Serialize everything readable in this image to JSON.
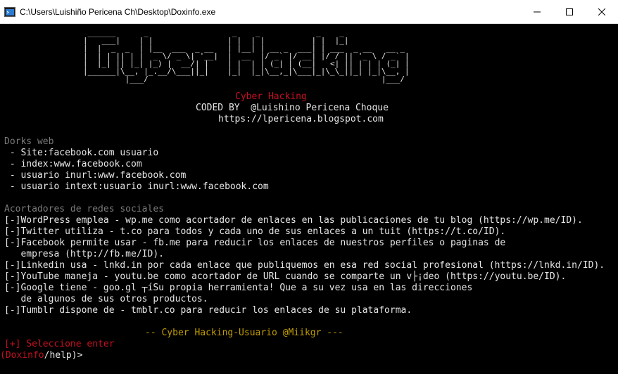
{
  "window": {
    "title": "C:\\Users\\Luishiño Pericena Ch\\Desktop\\Doxinfo.exe"
  },
  "banner": {
    "art": [
      " ______      _                  _    _            _    _             ",
      "|   ___|    | |                | |  | |          | |  |_|            ",
      "|  |  _  _  | |__  ___  _ __   | |__| | __ _  ___| | ___  _ __   __ _",
      "|  | | || | |  _ \\/ _ \\| '__|  |  __  |/ _` |/ __| |/ / || '_ \\ / _` |",
      "|  |_| || |_| |_) |  __/| |    | |  | | (_| | (__|   <| || | | | (_| |",
      "|______|\\__, |_.__/\\___||_|    |_|  |_|\\__,_|\\___|_|\\_\\_||_| |_|\\__, |",
      "         |___/                                                  |___/ "
    ],
    "title": "Cyber Hacking",
    "coded_by": "CODED BY  @Luishino Pericena Choque",
    "url": "https://lpericena.blogspot.com"
  },
  "dorks": {
    "heading": "Dorks web",
    "items": [
      " - Site:facebook.com usuario",
      " - index:www.facebook.com",
      " - usuario inurl:www.facebook.com",
      " - usuario intext:usuario inurl:www.facebook.com"
    ]
  },
  "shorteners": {
    "heading": "Acortadores de redes sociales",
    "lines": [
      "[-]WordPress emplea - wp.me como acortador de enlaces en las publicaciones de tu blog (https://wp.me/ID).",
      "[-]Twitter utiliza - t.co para todos y cada uno de sus enlaces a un tuit (https://t.co/ID).",
      "[-]Facebook permite usar - fb.me para reducir los enlaces de nuestros perfiles o paginas de",
      "   empresa (http://fb.me/ID).",
      "[-]Linkedin usa - lnkd.in por cada enlace que publiquemos en esa red social profesional (https://lnkd.in/ID).",
      "[-]YouTube maneja - youtu.be como acortador de URL cuando se comparte un v├¡deo (https://youtu.be/ID).",
      "[-]Google tiene - goo.gl ┬íSu propia herramienta! Que a su vez usa en las direcciones",
      "   de algunos de sus otros productos.",
      "[-]Tumblr dispone de - tmblr.co para reducir los enlaces de su plataforma."
    ]
  },
  "footer": "-- Cyber Hacking-Usuario @Miikgr ---",
  "prompt": {
    "select": "[+] Seleccione enter",
    "name": "Doxinfo",
    "path": "/help)>"
  },
  "colors": {
    "gray": "#7a7a7a",
    "white": "#e6e6e6",
    "red": "#c50f1f",
    "yellow": "#c19c00"
  },
  "icons": [
    "console-app-icon",
    "minimize-icon",
    "maximize-icon",
    "close-icon"
  ]
}
